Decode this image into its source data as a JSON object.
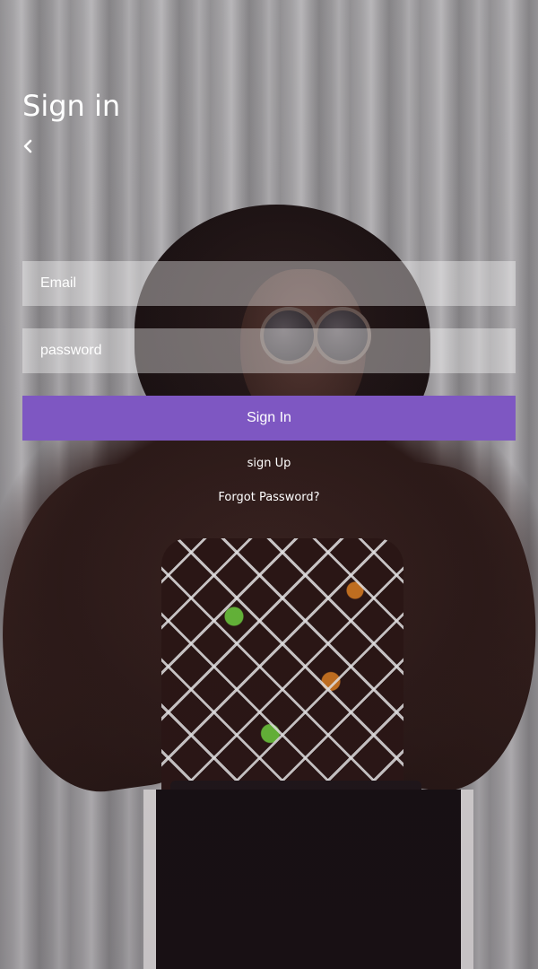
{
  "header": {
    "title": "Sign in",
    "back_icon": "chevron-left-icon"
  },
  "form": {
    "email_placeholder": "Email",
    "email_value": "",
    "password_placeholder": "password",
    "password_value": "",
    "submit_label": "Sign In"
  },
  "links": {
    "signup_label": "sign Up",
    "forgot_label": "Forgot Password?"
  },
  "colors": {
    "accent": "#7e57c2",
    "text": "#ffffff",
    "field_background": "rgba(255,255,255,0.38)"
  }
}
